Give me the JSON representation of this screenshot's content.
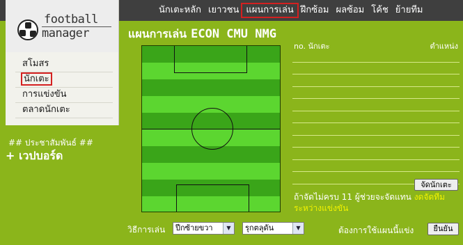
{
  "topnav": {
    "items": [
      "นักเตะหลัก",
      "เยาวชน",
      "แผนการเล่น",
      "ฝึกซ้อม",
      "ผลซ้อม",
      "โค้ช",
      "ย้ายทีม"
    ],
    "active_index": 2
  },
  "logo": {
    "line1": "football",
    "line2": "manager"
  },
  "sidebar": {
    "items": [
      "สโมสร",
      "นักเตะ",
      "การแข่งขัน",
      "ตลาดนักเตะ"
    ],
    "selected_index": 1
  },
  "pr": {
    "title": "## ประชาสัมพันธ์ ##",
    "webboard": "+ เวปบอร์ด"
  },
  "main": {
    "title_prefix": "แผนการเล่น",
    "team_name": "ECON CMU NMG",
    "roster": {
      "col_no": "no. นักเตะ",
      "col_pos": "ตำแหน่ง"
    },
    "arrange_button": "จัดนักเตะ",
    "note_main": "ถ้าจัดไม่ครบ 11 ผู้ช่วยจะจัดแทน",
    "note_highlight": "งดจัดทีมระหว่างแข่งขัน",
    "tactic_label": "วิธีการเล่น",
    "formation_value": "ปีกซ้ายขวา",
    "style_value": "รุกตลุดัน",
    "use_label": "ต้องการใช้แผนนี้แข่ง",
    "confirm_button": "ยืนยัน"
  },
  "colors": {
    "stripe_light": "#5cd630",
    "stripe_dark": "#3aa519",
    "bg": "#8bb51b",
    "topbar": "#3f3f3f"
  }
}
